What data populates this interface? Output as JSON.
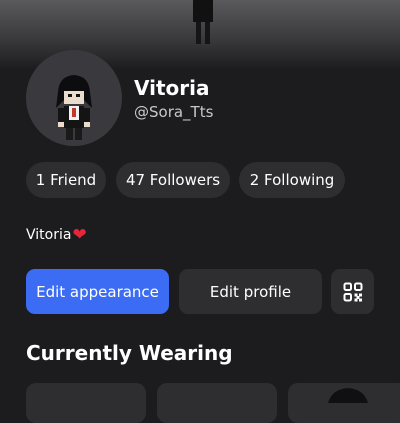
{
  "profile": {
    "display_name": "Vitoria",
    "username": "@Sora_Tts",
    "bio_text": "Vitoria",
    "bio_emoji": "❤"
  },
  "stats": {
    "friends": "1 Friend",
    "followers": "47 Followers",
    "following": "2 Following"
  },
  "actions": {
    "edit_appearance": "Edit appearance",
    "edit_profile": "Edit profile",
    "qr_icon": "qr-code-icon"
  },
  "section": {
    "currently_wearing": "Currently Wearing"
  },
  "colors": {
    "background": "#1c1c1e",
    "pill": "#2e2e31",
    "primary": "#3c6cf3",
    "heart": "#e3263a"
  }
}
